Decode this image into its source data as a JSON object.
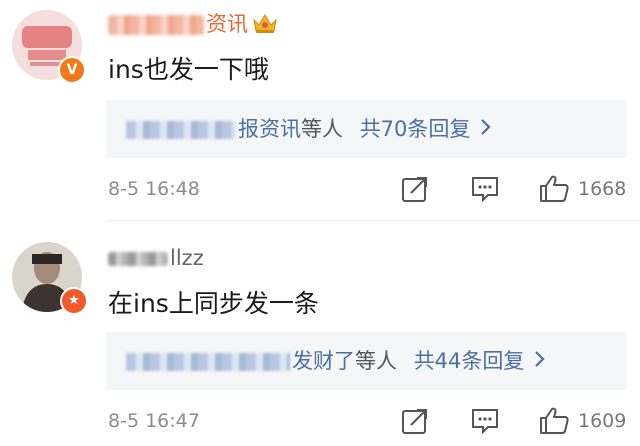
{
  "comments": [
    {
      "username_visible": "资讯",
      "content": "ins也发一下哦",
      "reply_summary": {
        "name_visible": "报资讯",
        "others": "等人",
        "count_text": "共70条回复"
      },
      "date": "8-5 16:48",
      "likes": "1668",
      "badge": "V"
    },
    {
      "username_visible": "llzz",
      "content": "在ins上同步发一条",
      "reply_summary": {
        "name_visible": "发财了",
        "others": "等人",
        "count_text": "共44条回复"
      },
      "date": "8-5 16:47",
      "likes": "1609",
      "badge": "★"
    }
  ],
  "colors": {
    "link_blue": "#4a6fa5",
    "orange_name": "#e36b34",
    "badge_orange": "#f07a1a",
    "reply_bg": "#f5f6f8",
    "meta_grey": "#8c8c8c"
  },
  "icons": [
    "share-icon",
    "comment-icon",
    "like-icon",
    "chevron-right-icon",
    "crown-icon",
    "verified-badge-icon"
  ]
}
